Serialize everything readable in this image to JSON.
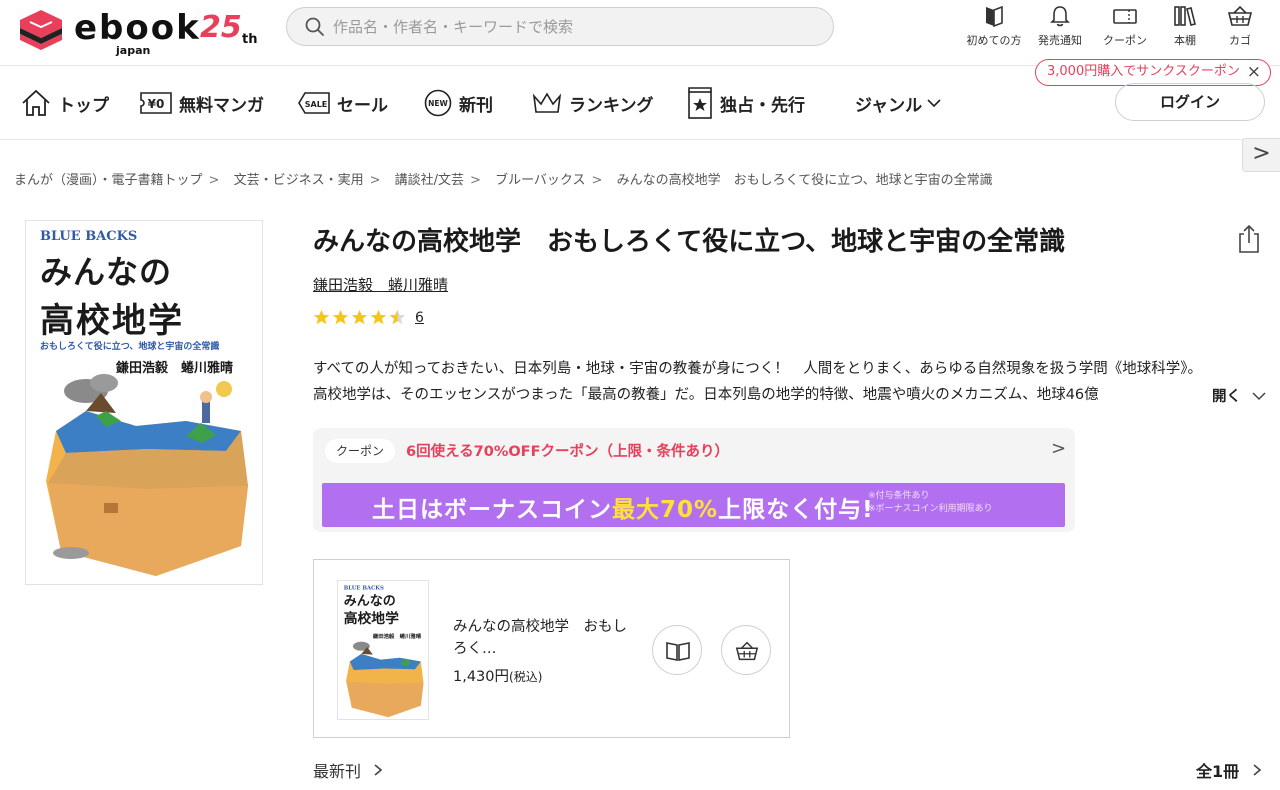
{
  "brand": {
    "logo_text": "ebook",
    "logo_sub": "japan",
    "anniversary": "25",
    "anniversary_suffix": "th",
    "accent_color": "#e83f5b"
  },
  "search": {
    "placeholder": "作品名・作者名・キーワードで検索",
    "icon": "search-icon"
  },
  "header_nav": [
    {
      "label": "初めての方",
      "icon": "book-open-icon"
    },
    {
      "label": "発売通知",
      "icon": "bell-icon"
    },
    {
      "label": "クーポン",
      "icon": "coupon-icon"
    },
    {
      "label": "本棚",
      "icon": "bookshelf-icon"
    },
    {
      "label": "カゴ",
      "icon": "cart-icon"
    }
  ],
  "coupon_notice": {
    "text": "3,000円購入でサンクスクーポン",
    "close": "×"
  },
  "main_nav": [
    {
      "label": "トップ",
      "icon": "home-icon"
    },
    {
      "label": "無料マンガ",
      "icon": "yen-zero-icon"
    },
    {
      "label": "セール",
      "icon": "sale-tag-icon"
    },
    {
      "label": "新刊",
      "icon": "new-badge-icon"
    },
    {
      "label": "ランキング",
      "icon": "crown-icon"
    },
    {
      "label": "独占・先行",
      "icon": "star-book-icon"
    },
    {
      "label": "ジャンル",
      "icon": "chevron-down-icon"
    }
  ],
  "login_label": "ログイン",
  "side_arrow": ">",
  "breadcrumb": [
    "まんが（漫画）・電子書籍トップ",
    "文芸・ビジネス・実用",
    "講談社/文芸",
    "ブルーバックス",
    "みんなの高校地学　おもしろくて役に立つ、地球と宇宙の全常識"
  ],
  "breadcrumb_sep": ">",
  "cover": {
    "series": "BLUE BACKS",
    "title_line1": "みんなの",
    "title_line2": "高校地学",
    "subtitle": "おもしろくて役に立つ、地球と宇宙の全常識",
    "authors": "鎌田浩毅　蜷川雅晴"
  },
  "book": {
    "title": "みんなの高校地学　おもしろくて役に立つ、地球と宇宙の全常識",
    "authors": "鎌田浩毅　蜷川雅晴",
    "rating": 4.5,
    "review_count": "6",
    "description": "すべての人が知っておきたい、日本列島・地球・宇宙の教養が身につく！　人間をとりまく、あらゆる自然現象を扱う学問《地球科学》。高校地学は、そのエッセンスがつまった「最高の教養」だ。日本列島の地学的特徴、地震や噴火のメカニズム、地球46億",
    "expand_label": "開く"
  },
  "promo": {
    "coupon_tag": "クーポン",
    "coupon_text": "6回使える70%OFFクーポン（上限・条件あり）",
    "arrow": ">",
    "banner_part1": "土日はボーナスコイン",
    "banner_highlight": "最大70%",
    "banner_part2": "上限なく付与!",
    "banner_note1": "※付与条件あり",
    "banner_note2": "※ボーナスコイン利用期限あり",
    "banner_color": "#b26ff0",
    "highlight_color": "#ffe13a"
  },
  "volume": {
    "title": "みんなの高校地学　おもしろく…",
    "price": "1,430円",
    "tax": "(税込)",
    "read_icon": "book-read-icon",
    "cart_icon": "cart-icon"
  },
  "footer_row": {
    "latest": "最新刊",
    "total": "全1冊"
  }
}
